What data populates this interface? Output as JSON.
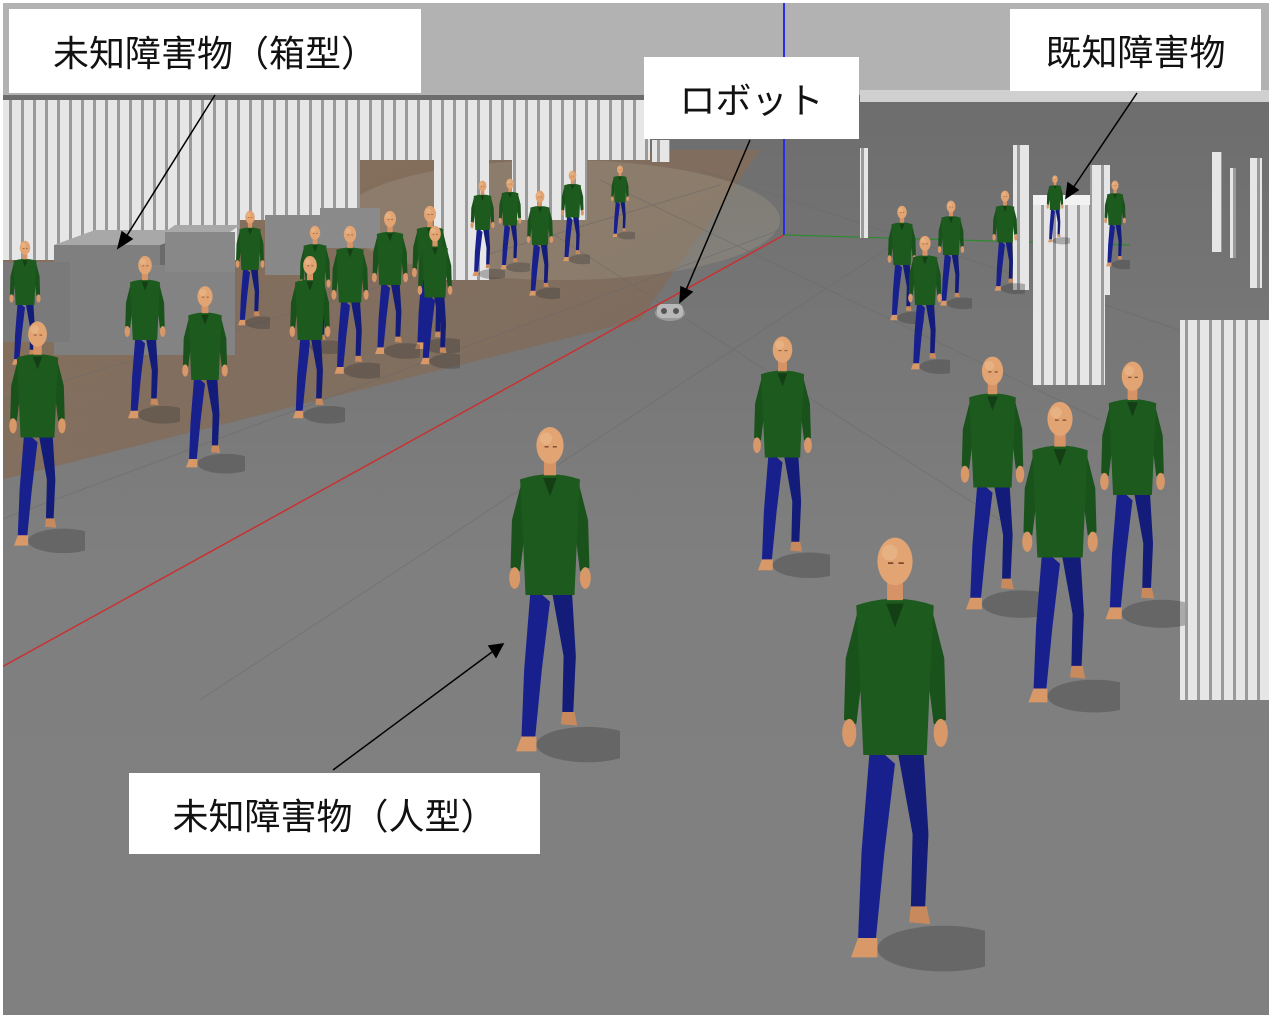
{
  "labels": {
    "unknown_box": "未知障害物（箱型）",
    "robot": "ロボット",
    "known": "既知障害物",
    "unknown_human": "未知障害物（人型）"
  },
  "colors": {
    "floor": "#7c7c7c",
    "sky": "#b4b4b4",
    "shirt": "#1d5a1e",
    "pants": "#18208e",
    "skin": "#e0a070",
    "column": "#e9e9e9",
    "box": "#7f7f7f",
    "axis_red": "#c83232",
    "axis_blue": "#2a2ae8",
    "axis_green": "#2e8a2e"
  }
}
